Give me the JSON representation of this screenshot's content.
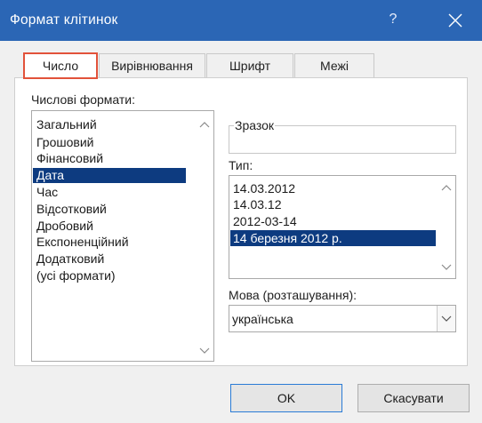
{
  "window": {
    "title": "Формат клітинок",
    "help_label": "?",
    "titlebar_color": "#2b66b5",
    "accent_color": "#0d3b80",
    "highlight_color": "#e2523a"
  },
  "tabs": [
    {
      "label": "Число",
      "active": true
    },
    {
      "label": "Вирівнювання",
      "active": false
    },
    {
      "label": "Шрифт",
      "active": false
    },
    {
      "label": "Межі",
      "active": false
    }
  ],
  "number_formats": {
    "label": "Числові формати:",
    "items": [
      "Загальний",
      "Грошовий",
      "Фінансовий",
      "Дата",
      "Час",
      "Відсотковий",
      "Дробовий",
      "Експоненційний",
      "Додатковий",
      "(усі формати)"
    ],
    "selected": "Дата"
  },
  "sample": {
    "label": "Зразок",
    "value": ""
  },
  "type": {
    "label": "Тип:",
    "items": [
      "14.03.2012",
      "14.03.12",
      "2012-03-14",
      "14 березня 2012 р."
    ],
    "selected": "14 березня 2012 р."
  },
  "locale": {
    "label": "Мова (розташування):",
    "value": "українська"
  },
  "buttons": {
    "ok": "OK",
    "cancel": "Скасувати"
  }
}
